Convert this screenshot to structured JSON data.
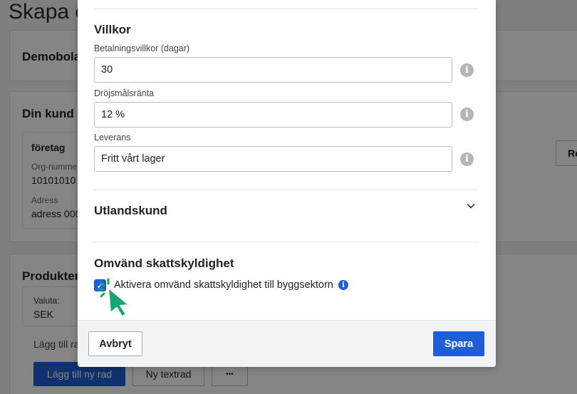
{
  "background": {
    "title": "Skapa e",
    "company_heading": "Demobola",
    "customer_heading": "Din kund",
    "customer_type": "företag",
    "org_label": "Org-numme",
    "org_value": "10101010",
    "address_label": "Adress",
    "address_value": "adress 000",
    "right_button": "Re",
    "products_heading": "Produkter",
    "currency_label": "Valuta:",
    "currency_value": "SEK",
    "add_row_text": "Lägg till ra",
    "add_new_row_button": "Lägg till ny rad",
    "new_text_row_button": "Ny textrad",
    "more_button": "•••"
  },
  "modal": {
    "terms_section": {
      "title": "Villkor",
      "payment_terms_label": "Betalningsvillkor (dagar)",
      "payment_terms_value": "30",
      "late_interest_label": "Dröjsmålsränta",
      "late_interest_value": "12 %",
      "delivery_label": "Leverans",
      "delivery_value": "Fritt vårt lager",
      "info_glyph": "i"
    },
    "foreign_section": {
      "title": "Utlandskund",
      "expanded": false
    },
    "reverse_charge_section": {
      "title": "Omvänd skattskyldighet",
      "checkbox_label": "Aktivera omvänd skattskyldighet till byggsektorn",
      "checked": true,
      "check_glyph": "✓",
      "info_glyph": "i"
    },
    "footer": {
      "cancel_label": "Avbryt",
      "save_label": "Spara"
    }
  },
  "colors": {
    "primary": "#1f5ed6",
    "cursor": "#1aa36f",
    "info_grey": "#b5b5b5"
  }
}
